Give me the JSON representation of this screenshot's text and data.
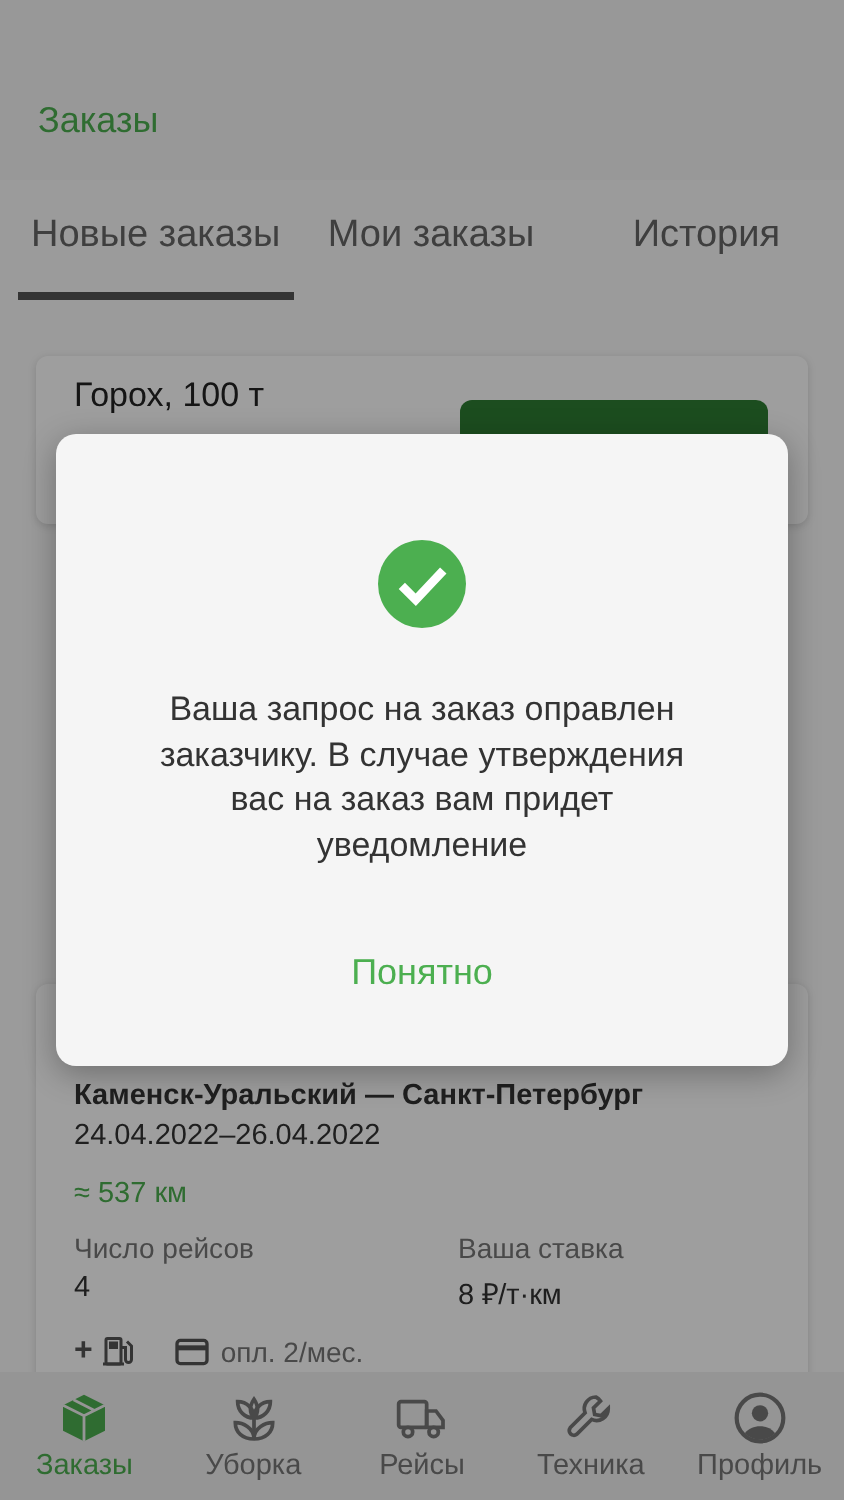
{
  "header": {
    "title": "Заказы"
  },
  "tabs": [
    {
      "label": "Новые заказы",
      "selected": true
    },
    {
      "label": "Мои заказы",
      "selected": false
    },
    {
      "label": "История",
      "selected": false
    }
  ],
  "orders": [
    {
      "cargo": "Горох, 100 т"
    },
    {
      "route": "Каменск-Уральский — Санкт-Петербург",
      "dates": "24.04.2022–26.04.2022",
      "distance": "≈ 537 км",
      "trips_label": "Число рейсов",
      "trips": "4",
      "rate_label": "Ваша ставка",
      "rate": "8 ₽/т·км",
      "fuel_mark": "+",
      "payment": "опл. 2/мес."
    }
  ],
  "dialog": {
    "message": "Ваша запрос на заказ оправлен заказчику. В случае утверждения вас на заказ вам придет уведомление",
    "button": "Понятно"
  },
  "nav": [
    {
      "label": "Заказы",
      "selected": true
    },
    {
      "label": "Уборка",
      "selected": false
    },
    {
      "label": "Рейсы",
      "selected": false
    },
    {
      "label": "Техника",
      "selected": false
    },
    {
      "label": "Профиль",
      "selected": false
    }
  ]
}
